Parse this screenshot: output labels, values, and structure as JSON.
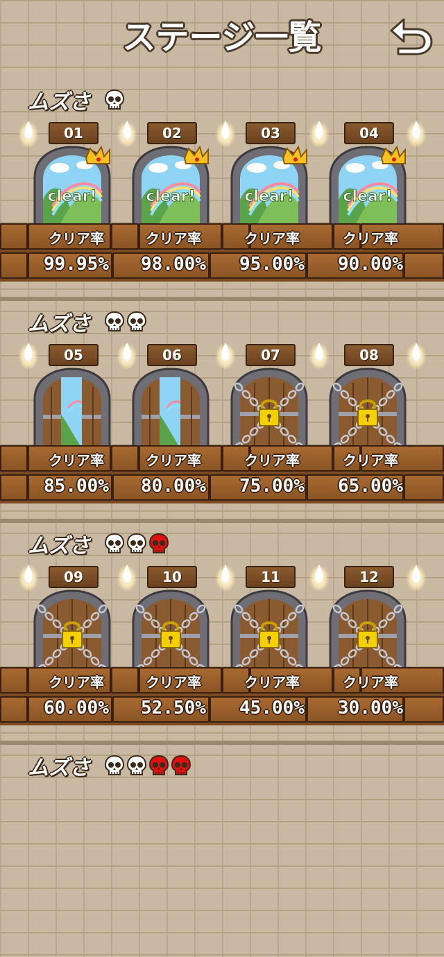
{
  "header": {
    "title": "ステージ一覧",
    "back_icon": "undo-arrow-icon"
  },
  "colors": {
    "skull_white": "#ffffff",
    "skull_red": "#e01010",
    "wood": "#8a5424",
    "brick_wall": "#c9b9a2"
  },
  "sections": [
    {
      "difficulty_label": "ムズさ",
      "skulls": [
        "white"
      ],
      "stages": [
        {
          "num": "01",
          "state": "cleared",
          "clear_text": "clear!",
          "crown": true,
          "rate_label": "クリア率",
          "rate": "99.95%"
        },
        {
          "num": "02",
          "state": "cleared",
          "clear_text": "clear!",
          "crown": true,
          "rate_label": "クリア率",
          "rate": "98.00%"
        },
        {
          "num": "03",
          "state": "cleared",
          "clear_text": "clear!",
          "crown": true,
          "rate_label": "クリア率",
          "rate": "95.00%"
        },
        {
          "num": "04",
          "state": "cleared",
          "clear_text": "clear!",
          "crown": true,
          "rate_label": "クリア率",
          "rate": "90.00%"
        }
      ]
    },
    {
      "difficulty_label": "ムズさ",
      "skulls": [
        "white",
        "white"
      ],
      "stages": [
        {
          "num": "05",
          "state": "open",
          "rate_label": "クリア率",
          "rate": "85.00%"
        },
        {
          "num": "06",
          "state": "open",
          "rate_label": "クリア率",
          "rate": "80.00%"
        },
        {
          "num": "07",
          "state": "locked",
          "rate_label": "クリア率",
          "rate": "75.00%"
        },
        {
          "num": "08",
          "state": "locked",
          "rate_label": "クリア率",
          "rate": "65.00%"
        }
      ]
    },
    {
      "difficulty_label": "ムズさ",
      "skulls": [
        "white",
        "white",
        "red"
      ],
      "stages": [
        {
          "num": "09",
          "state": "locked",
          "rate_label": "クリア率",
          "rate": "60.00%"
        },
        {
          "num": "10",
          "state": "locked",
          "rate_label": "クリア率",
          "rate": "52.50%"
        },
        {
          "num": "11",
          "state": "locked",
          "rate_label": "クリア率",
          "rate": "45.00%"
        },
        {
          "num": "12",
          "state": "locked",
          "rate_label": "クリア率",
          "rate": "30.00%"
        }
      ]
    },
    {
      "difficulty_label": "ムズさ",
      "skulls": [
        "white",
        "white",
        "red",
        "red"
      ],
      "stages": []
    }
  ]
}
